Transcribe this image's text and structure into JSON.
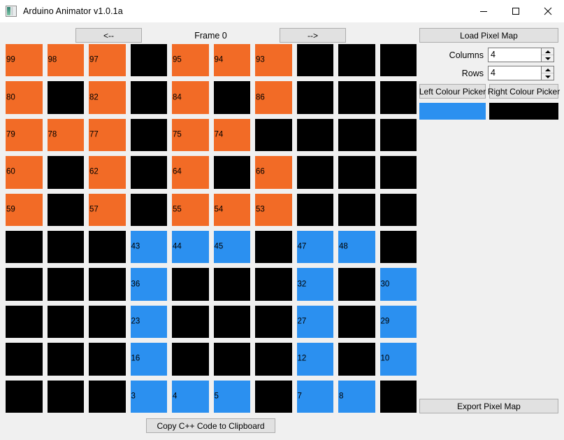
{
  "window": {
    "title": "Arduino Animator v1.0.1a",
    "icon": "image-icon",
    "controls": {
      "minimize": "minimize-icon",
      "maximize": "maximize-icon",
      "close": "close-icon"
    }
  },
  "toolbar": {
    "prev_label": "<--",
    "next_label": "-->",
    "frame_label": "Frame 0"
  },
  "panel": {
    "load_label": "Load Pixel Map",
    "columns_label": "Columns",
    "columns_value": "4",
    "rows_label": "Rows",
    "rows_value": "4",
    "left_picker_label": "Left Colour Picker",
    "right_picker_label": "Right Colour Picker",
    "left_swatch_color": "#2b90f0",
    "right_swatch_color": "#000000",
    "export_label": "Export Pixel Map"
  },
  "footer": {
    "copy_label": "Copy C++ Code to Clipboard"
  },
  "colors": {
    "orange": "#f26b26",
    "blue": "#2b90f0",
    "black": "#000000",
    "background": "#f0f0f0"
  },
  "grid": {
    "columns": 10,
    "rows": 10,
    "cells": [
      {
        "label": "99",
        "color": "#f26b26"
      },
      {
        "label": "98",
        "color": "#f26b26"
      },
      {
        "label": "97",
        "color": "#f26b26"
      },
      {
        "label": "",
        "color": "#000000"
      },
      {
        "label": "95",
        "color": "#f26b26"
      },
      {
        "label": "94",
        "color": "#f26b26"
      },
      {
        "label": "93",
        "color": "#f26b26"
      },
      {
        "label": "",
        "color": "#000000"
      },
      {
        "label": "",
        "color": "#000000"
      },
      {
        "label": "",
        "color": "#000000"
      },
      {
        "label": "80",
        "color": "#f26b26"
      },
      {
        "label": "",
        "color": "#000000"
      },
      {
        "label": "82",
        "color": "#f26b26"
      },
      {
        "label": "",
        "color": "#000000"
      },
      {
        "label": "84",
        "color": "#f26b26"
      },
      {
        "label": "",
        "color": "#000000"
      },
      {
        "label": "86",
        "color": "#f26b26"
      },
      {
        "label": "",
        "color": "#000000"
      },
      {
        "label": "",
        "color": "#000000"
      },
      {
        "label": "",
        "color": "#000000"
      },
      {
        "label": "79",
        "color": "#f26b26"
      },
      {
        "label": "78",
        "color": "#f26b26"
      },
      {
        "label": "77",
        "color": "#f26b26"
      },
      {
        "label": "",
        "color": "#000000"
      },
      {
        "label": "75",
        "color": "#f26b26"
      },
      {
        "label": "74",
        "color": "#f26b26"
      },
      {
        "label": "",
        "color": "#000000"
      },
      {
        "label": "",
        "color": "#000000"
      },
      {
        "label": "",
        "color": "#000000"
      },
      {
        "label": "",
        "color": "#000000"
      },
      {
        "label": "60",
        "color": "#f26b26"
      },
      {
        "label": "",
        "color": "#000000"
      },
      {
        "label": "62",
        "color": "#f26b26"
      },
      {
        "label": "",
        "color": "#000000"
      },
      {
        "label": "64",
        "color": "#f26b26"
      },
      {
        "label": "",
        "color": "#000000"
      },
      {
        "label": "66",
        "color": "#f26b26"
      },
      {
        "label": "",
        "color": "#000000"
      },
      {
        "label": "",
        "color": "#000000"
      },
      {
        "label": "",
        "color": "#000000"
      },
      {
        "label": "59",
        "color": "#f26b26"
      },
      {
        "label": "",
        "color": "#000000"
      },
      {
        "label": "57",
        "color": "#f26b26"
      },
      {
        "label": "",
        "color": "#000000"
      },
      {
        "label": "55",
        "color": "#f26b26"
      },
      {
        "label": "54",
        "color": "#f26b26"
      },
      {
        "label": "53",
        "color": "#f26b26"
      },
      {
        "label": "",
        "color": "#000000"
      },
      {
        "label": "",
        "color": "#000000"
      },
      {
        "label": "",
        "color": "#000000"
      },
      {
        "label": "",
        "color": "#000000"
      },
      {
        "label": "",
        "color": "#000000"
      },
      {
        "label": "",
        "color": "#000000"
      },
      {
        "label": "43",
        "color": "#2b90f0"
      },
      {
        "label": "44",
        "color": "#2b90f0"
      },
      {
        "label": "45",
        "color": "#2b90f0"
      },
      {
        "label": "",
        "color": "#000000"
      },
      {
        "label": "47",
        "color": "#2b90f0"
      },
      {
        "label": "48",
        "color": "#2b90f0"
      },
      {
        "label": "",
        "color": "#000000"
      },
      {
        "label": "",
        "color": "#000000"
      },
      {
        "label": "",
        "color": "#000000"
      },
      {
        "label": "",
        "color": "#000000"
      },
      {
        "label": "36",
        "color": "#2b90f0"
      },
      {
        "label": "",
        "color": "#000000"
      },
      {
        "label": "",
        "color": "#000000"
      },
      {
        "label": "",
        "color": "#000000"
      },
      {
        "label": "32",
        "color": "#2b90f0"
      },
      {
        "label": "",
        "color": "#000000"
      },
      {
        "label": "30",
        "color": "#2b90f0"
      },
      {
        "label": "",
        "color": "#000000"
      },
      {
        "label": "",
        "color": "#000000"
      },
      {
        "label": "",
        "color": "#000000"
      },
      {
        "label": "23",
        "color": "#2b90f0"
      },
      {
        "label": "",
        "color": "#000000"
      },
      {
        "label": "",
        "color": "#000000"
      },
      {
        "label": "",
        "color": "#000000"
      },
      {
        "label": "27",
        "color": "#2b90f0"
      },
      {
        "label": "",
        "color": "#000000"
      },
      {
        "label": "29",
        "color": "#2b90f0"
      },
      {
        "label": "",
        "color": "#000000"
      },
      {
        "label": "",
        "color": "#000000"
      },
      {
        "label": "",
        "color": "#000000"
      },
      {
        "label": "16",
        "color": "#2b90f0"
      },
      {
        "label": "",
        "color": "#000000"
      },
      {
        "label": "",
        "color": "#000000"
      },
      {
        "label": "",
        "color": "#000000"
      },
      {
        "label": "12",
        "color": "#2b90f0"
      },
      {
        "label": "",
        "color": "#000000"
      },
      {
        "label": "10",
        "color": "#2b90f0"
      },
      {
        "label": "",
        "color": "#000000"
      },
      {
        "label": "",
        "color": "#000000"
      },
      {
        "label": "",
        "color": "#000000"
      },
      {
        "label": "3",
        "color": "#2b90f0"
      },
      {
        "label": "4",
        "color": "#2b90f0"
      },
      {
        "label": "5",
        "color": "#2b90f0"
      },
      {
        "label": "",
        "color": "#000000"
      },
      {
        "label": "7",
        "color": "#2b90f0"
      },
      {
        "label": "8",
        "color": "#2b90f0"
      },
      {
        "label": "",
        "color": "#000000"
      }
    ]
  }
}
